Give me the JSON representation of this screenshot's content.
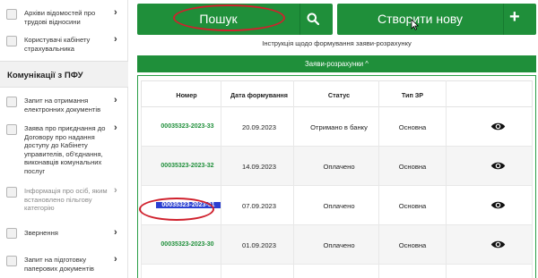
{
  "sidebar": {
    "items_top": [
      {
        "label": "Архіви відомостей про трудові відносини",
        "icon": "archive-icon"
      },
      {
        "label": "Користувачі кабінету страхувальника",
        "icon": "users-icon"
      }
    ],
    "section_heading": "Комунікації з ПФУ",
    "items": [
      {
        "label": "Запит на отримання електронних документів",
        "icon": "document-request-icon",
        "muted": false
      },
      {
        "label": "Заява про приєднання до Договору про надання доступу до Кабінету управителів, об'єднання, виконавців комунальних послуг",
        "icon": "application-icon",
        "muted": false
      },
      {
        "label": "Інформація про осіб, яким встановлено пільгову категорію",
        "icon": "info-icon",
        "muted": true
      },
      {
        "label": "Звернення",
        "icon": "appeal-icon",
        "muted": false
      },
      {
        "label": "Запит на підготовку паперових документів",
        "icon": "paper-request-icon",
        "muted": false
      }
    ]
  },
  "toolbar": {
    "search_label": "Пошук",
    "create_label": "Створити нову",
    "create_plus": "+"
  },
  "instruction_link": "Інструкція щодо формування заяви-розрахунку",
  "section_bar": {
    "label": "Заяви-розрахунки ^"
  },
  "table": {
    "columns": [
      "Номер",
      "Дата формування",
      "Статус",
      "Тип ЗР"
    ],
    "rows": [
      {
        "number": "00035323-2023-33",
        "date": "20.09.2023",
        "status": "Отримано в банку",
        "type": "Основна",
        "selected": false
      },
      {
        "number": "00035323-2023-32",
        "date": "14.09.2023",
        "status": "Оплачено",
        "type": "Основна",
        "selected": false
      },
      {
        "number": "00035323-2023-31",
        "date": "07.09.2023",
        "status": "Оплачено",
        "type": "Основна",
        "selected": true
      },
      {
        "number": "00035323-2023-30",
        "date": "01.09.2023",
        "status": "Оплачено",
        "type": "Основна",
        "selected": false
      }
    ]
  },
  "colors": {
    "accent_green": "#1f8f3a",
    "highlight_red": "#d0212d",
    "selection_blue": "#2a3fd1"
  }
}
